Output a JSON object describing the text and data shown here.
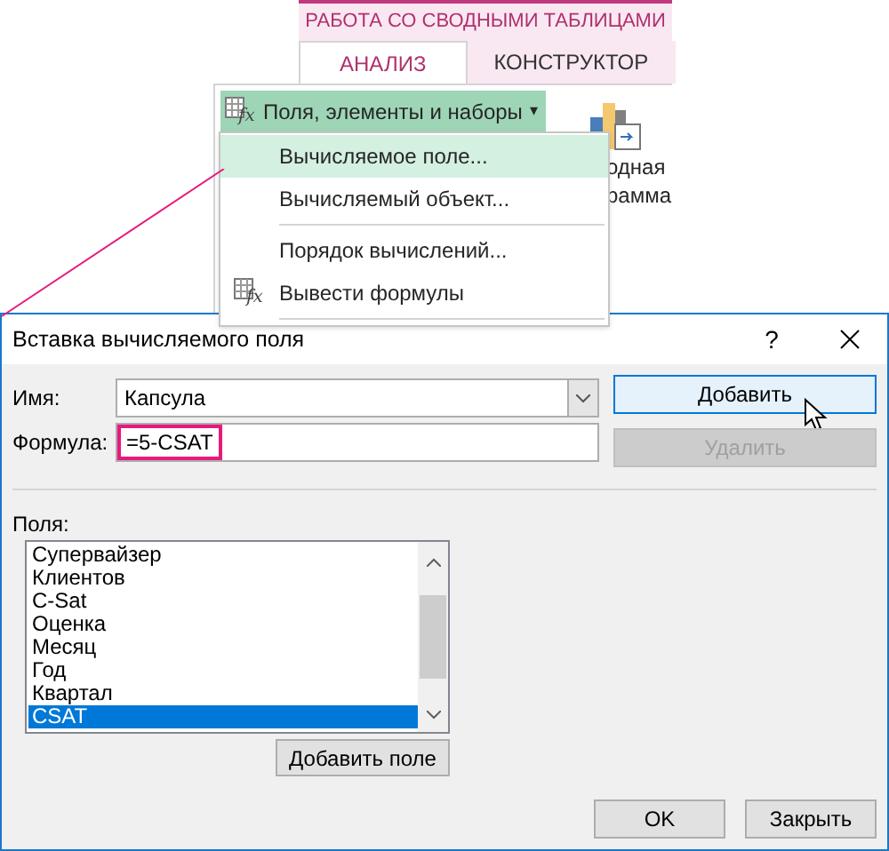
{
  "ribbon": {
    "context_header": "РАБОТА СО СВОДНЫМИ ТАБЛИЦАМИ",
    "tabs": [
      {
        "label": "АНАЛИЗ",
        "selected": true
      },
      {
        "label": "КОНСТРУКТОР",
        "selected": false
      }
    ],
    "fields_button": {
      "icon_text": "fx",
      "label": "Поля, элементы и наборы",
      "caret": "▾"
    },
    "chart_button": {
      "lines": [
        "одная",
        "рамма"
      ]
    },
    "menu": [
      {
        "kind": "item",
        "label": "Вычисляемое поле...",
        "selected": true
      },
      {
        "kind": "item",
        "label": "Вычисляемый объект...",
        "selected": false
      },
      {
        "kind": "separator"
      },
      {
        "kind": "item",
        "label": "Порядок вычислений...",
        "selected": false
      },
      {
        "kind": "item",
        "label": "Вывести формулы",
        "icon_text": "fx",
        "selected": false
      },
      {
        "kind": "separator"
      }
    ]
  },
  "dialog": {
    "title": "Вставка вычисляемого поля",
    "help": "?",
    "name_label": "Имя:",
    "name_value": "Капсула",
    "formula_label": "Формула:",
    "formula_value": "=5-CSAT",
    "buttons_side": [
      {
        "label": "Добавить",
        "disabled": false,
        "hovered": true
      },
      {
        "label": "Удалить",
        "disabled": true,
        "hovered": false
      }
    ],
    "fields_label": "Поля:",
    "fields": [
      {
        "label": "Супервайзер",
        "selected": false
      },
      {
        "label": "Клиентов",
        "selected": false
      },
      {
        "label": "C-Sat",
        "selected": false
      },
      {
        "label": "Оценка",
        "selected": false
      },
      {
        "label": "Месяц",
        "selected": false
      },
      {
        "label": "Год",
        "selected": false
      },
      {
        "label": "Квартал",
        "selected": false
      },
      {
        "label": "CSAT",
        "selected": true
      }
    ],
    "add_field_button": "Добавить поле",
    "buttons_bottom": [
      "OK",
      "Закрыть"
    ]
  }
}
